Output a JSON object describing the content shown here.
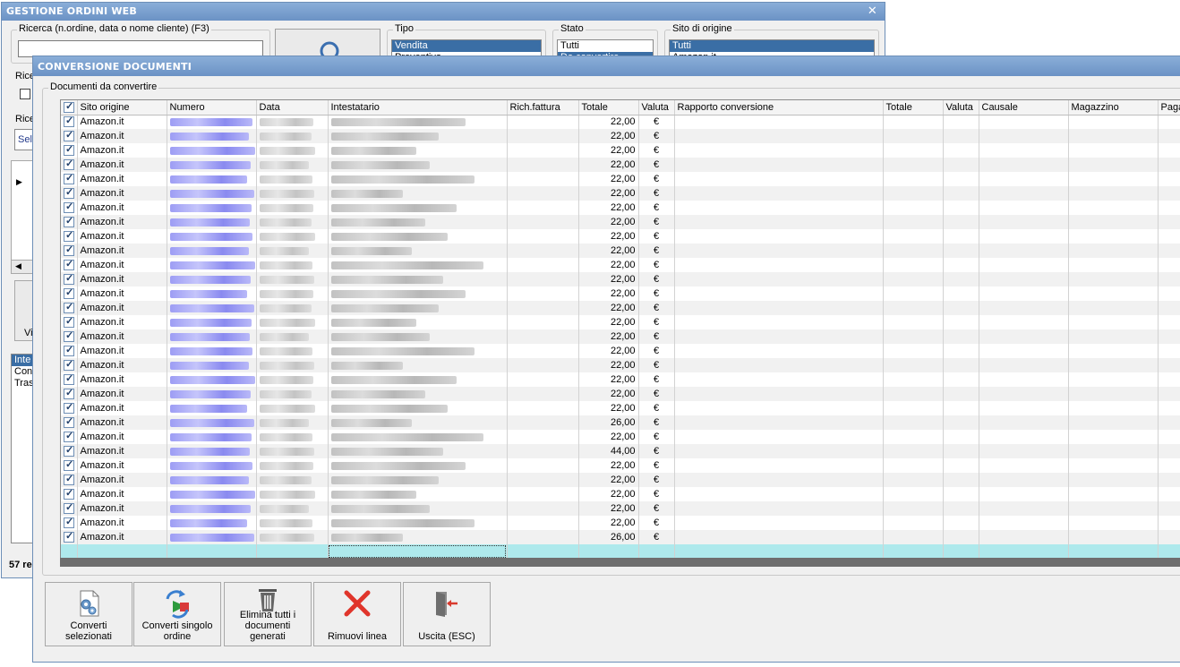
{
  "back_window": {
    "title": "GESTIONE ORDINI WEB",
    "search_label": "Ricerca (n.ordine, data o nome cliente) (F3)",
    "tipo_label": "Tipo",
    "tipo_options": [
      "Vendita",
      "Preventivo"
    ],
    "stato_label": "Stato",
    "stato_options": [
      "Tutti",
      "Da convertire"
    ],
    "sito_label": "Sito di origine",
    "sito_options": [
      "Tutti",
      "Amazon.it"
    ],
    "left_fragments": [
      "Rice",
      "Rice",
      "Sele",
      "Vi"
    ],
    "left_list": [
      "Inte",
      "Con",
      "Tras"
    ],
    "records_fragment": "57 re"
  },
  "front_window": {
    "title": "CONVERSIONE DOCUMENTI",
    "group_label": "Documenti da convertire"
  },
  "grid": {
    "columns": [
      "Sito origine",
      "Numero",
      "Data",
      "Intestatario",
      "Rich.fattura",
      "Totale",
      "Valuta",
      "Rapporto conversione",
      "Totale",
      "Valuta",
      "Causale",
      "Magazzino",
      "Paga"
    ],
    "rows": [
      {
        "site": "Amazon.it",
        "total": "22,00",
        "currency": "€"
      },
      {
        "site": "Amazon.it",
        "total": "22,00",
        "currency": "€"
      },
      {
        "site": "Amazon.it",
        "total": "22,00",
        "currency": "€"
      },
      {
        "site": "Amazon.it",
        "total": "22,00",
        "currency": "€"
      },
      {
        "site": "Amazon.it",
        "total": "22,00",
        "currency": "€"
      },
      {
        "site": "Amazon.it",
        "total": "22,00",
        "currency": "€"
      },
      {
        "site": "Amazon.it",
        "total": "22,00",
        "currency": "€"
      },
      {
        "site": "Amazon.it",
        "total": "22,00",
        "currency": "€"
      },
      {
        "site": "Amazon.it",
        "total": "22,00",
        "currency": "€"
      },
      {
        "site": "Amazon.it",
        "total": "22,00",
        "currency": "€"
      },
      {
        "site": "Amazon.it",
        "total": "22,00",
        "currency": "€"
      },
      {
        "site": "Amazon.it",
        "total": "22,00",
        "currency": "€"
      },
      {
        "site": "Amazon.it",
        "total": "22,00",
        "currency": "€"
      },
      {
        "site": "Amazon.it",
        "total": "22,00",
        "currency": "€"
      },
      {
        "site": "Amazon.it",
        "total": "22,00",
        "currency": "€"
      },
      {
        "site": "Amazon.it",
        "total": "22,00",
        "currency": "€"
      },
      {
        "site": "Amazon.it",
        "total": "22,00",
        "currency": "€"
      },
      {
        "site": "Amazon.it",
        "total": "22,00",
        "currency": "€"
      },
      {
        "site": "Amazon.it",
        "total": "22,00",
        "currency": "€"
      },
      {
        "site": "Amazon.it",
        "total": "22,00",
        "currency": "€"
      },
      {
        "site": "Amazon.it",
        "total": "22,00",
        "currency": "€"
      },
      {
        "site": "Amazon.it",
        "total": "26,00",
        "currency": "€"
      },
      {
        "site": "Amazon.it",
        "total": "22,00",
        "currency": "€"
      },
      {
        "site": "Amazon.it",
        "total": "44,00",
        "currency": "€"
      },
      {
        "site": "Amazon.it",
        "total": "22,00",
        "currency": "€"
      },
      {
        "site": "Amazon.it",
        "total": "22,00",
        "currency": "€"
      },
      {
        "site": "Amazon.it",
        "total": "22,00",
        "currency": "€"
      },
      {
        "site": "Amazon.it",
        "total": "22,00",
        "currency": "€"
      },
      {
        "site": "Amazon.it",
        "total": "22,00",
        "currency": "€"
      },
      {
        "site": "Amazon.it",
        "total": "26,00",
        "currency": "€"
      }
    ]
  },
  "buttons": [
    {
      "label": "Converti selezionati",
      "icon": "gears-document-icon"
    },
    {
      "label": "Converti singolo ordine",
      "icon": "convert-arrows-icon"
    },
    {
      "label": "Elimina tutti i documenti generati",
      "icon": "trash-bin-icon"
    },
    {
      "label": "Rimuovi linea",
      "icon": "red-x-icon"
    },
    {
      "label": "Uscita (ESC)",
      "icon": "exit-door-icon"
    }
  ],
  "colors": {
    "titlebar": "#7aa0d0",
    "selection": "#3a6ea5",
    "new_row": "#aee9ec",
    "blurred_numero": "#9d9df4"
  }
}
